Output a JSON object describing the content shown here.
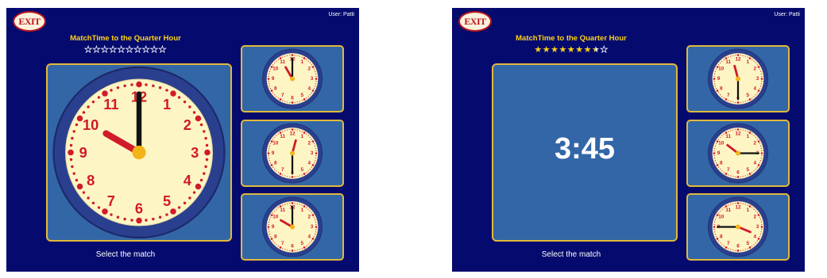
{
  "screens": [
    {
      "exit_label": "EXIT",
      "user": "User: Patti",
      "title": "MatchTime to the Quarter Hour",
      "stars": [
        "empty",
        "empty",
        "empty",
        "empty",
        "empty",
        "empty",
        "empty",
        "empty",
        "empty",
        "empty"
      ],
      "main": {
        "type": "clock",
        "hour": 10,
        "minute": 0
      },
      "options": [
        {
          "hour": 11,
          "minute": 0
        },
        {
          "hour": 12,
          "minute": 30
        },
        {
          "hour": 10,
          "minute": 0
        }
      ],
      "prompt": "Select the match"
    },
    {
      "exit_label": "EXIT",
      "user": "User: Patti",
      "title": "MatchTime to the Quarter Hour",
      "stars": [
        "full",
        "full",
        "full",
        "full",
        "full",
        "full",
        "full",
        "half",
        "empty"
      ],
      "main": {
        "type": "digital",
        "time": "3:45"
      },
      "options": [
        {
          "hour": 11,
          "minute": 30
        },
        {
          "hour": 10,
          "minute": 15
        },
        {
          "hour": 3,
          "minute": 45
        }
      ],
      "prompt": "Select the match"
    }
  ]
}
